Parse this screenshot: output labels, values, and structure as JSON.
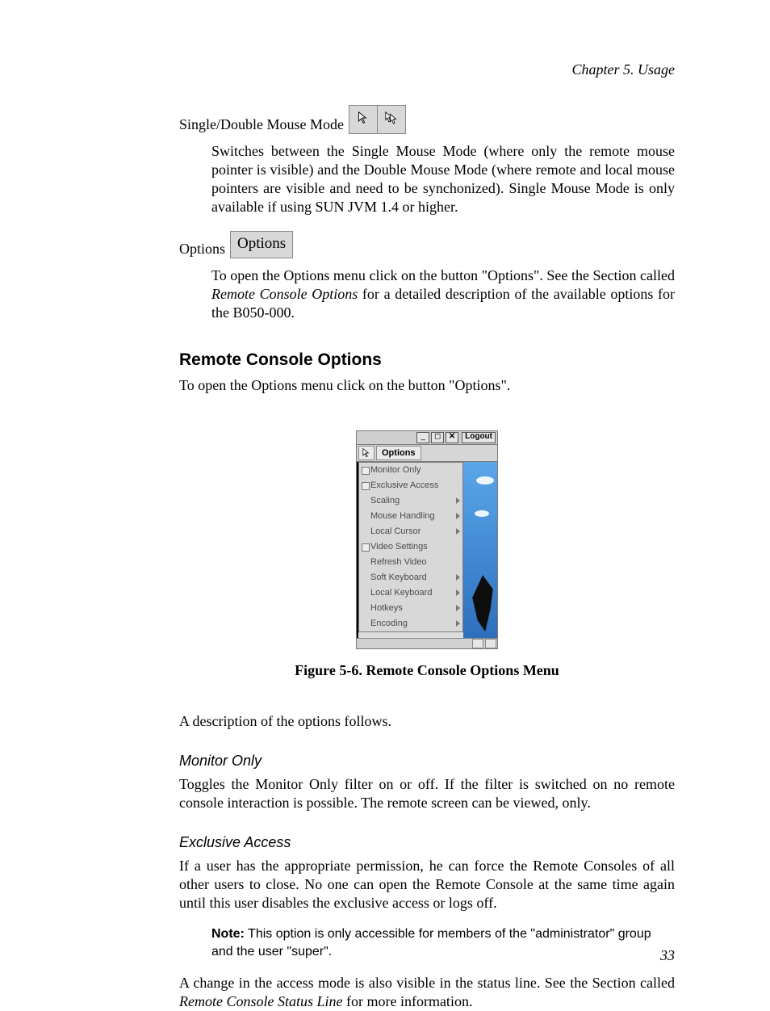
{
  "running_head": "Chapter 5. Usage",
  "mouse_mode": {
    "label": "Single/Double Mouse Mode",
    "desc": "Switches between the Single Mouse Mode (where only the remote mouse pointer is visible) and the Double Mouse Mode (where remote and local mouse pointers are visible and need to be synchonized). Single Mouse Mode is only available if using SUN JVM 1.4 or higher."
  },
  "options_entry": {
    "label": "Options",
    "button_text": "Options",
    "desc_1": "To open the Options menu click on the button \"Options\". See the Section called ",
    "desc_ref": "Remote Console Options",
    "desc_2": " for a detailed description of the available options for the B050-000."
  },
  "section": {
    "heading": "Remote Console Options",
    "intro": "To open the Options menu click on the button \"Options\"."
  },
  "figure": {
    "caption": "Figure 5-6. Remote Console Options Menu",
    "titlebar_buttons": [
      "_",
      "◻",
      "✕"
    ],
    "logout": "Logout",
    "toolbar_options": "Options",
    "menu_items": [
      {
        "label": "Monitor Only",
        "checkbox": true,
        "submenu": false
      },
      {
        "label": "Exclusive Access",
        "checkbox": true,
        "submenu": false
      },
      {
        "label": "Scaling",
        "checkbox": false,
        "submenu": true
      },
      {
        "label": "Mouse Handling",
        "checkbox": false,
        "submenu": true
      },
      {
        "label": "Local Cursor",
        "checkbox": false,
        "submenu": true
      },
      {
        "label": "Video Settings",
        "checkbox": true,
        "submenu": false
      },
      {
        "label": "Refresh Video",
        "checkbox": false,
        "submenu": false
      },
      {
        "label": "Soft Keyboard",
        "checkbox": false,
        "submenu": true
      },
      {
        "label": "Local Keyboard",
        "checkbox": false,
        "submenu": true
      },
      {
        "label": "Hotkeys",
        "checkbox": false,
        "submenu": true
      },
      {
        "label": "Encoding",
        "checkbox": false,
        "submenu": true
      }
    ]
  },
  "after_figure": "A description of the options follows.",
  "monitor_only": {
    "heading": "Monitor Only",
    "body": "Toggles the Monitor Only filter on or off. If the filter is switched on no remote console interaction is possible. The remote screen can be viewed, only."
  },
  "exclusive": {
    "heading": "Exclusive Access",
    "body": "If a user has the appropriate permission, he can force the Remote Consoles of all other users to close. No one can open the Remote Console at the same time again until this user disables the exclusive access or logs off.",
    "note_label": "Note:",
    "note_body": " This option is only accessible for members of the \"administrator\" group and the user \"super\".",
    "after_1": "A change in the access mode is also visible in the status line. See the Section called ",
    "after_ref": "Remote Console Status Line",
    "after_2": " for more information."
  },
  "page_number": "33"
}
